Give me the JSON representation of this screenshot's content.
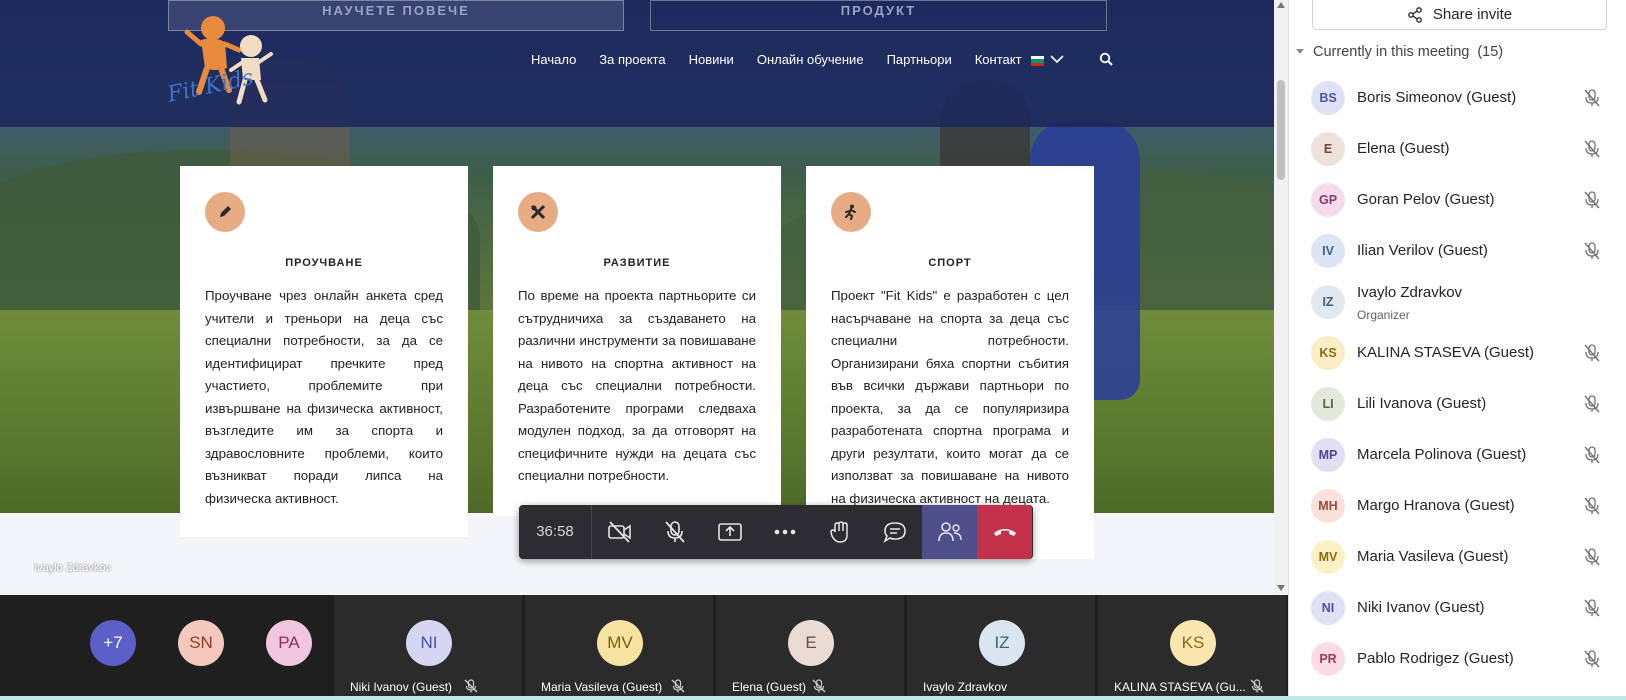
{
  "website": {
    "top_buttons": [
      "НАУЧЕТЕ ПОВЕЧЕ",
      "ПРОДУКТ"
    ],
    "logo_text": "Fit Kids",
    "nav": [
      "Начало",
      "За проекта",
      "Новини",
      "Онлайн обучение",
      "Партньори",
      "Контакт"
    ],
    "cards": [
      {
        "title": "ПРОУЧВАНЕ",
        "icon": "pencil-icon",
        "text": "Проучване чрез онлайн анкета сред учители и треньори на деца със специални потребности, за да се идентифицират пречките пред участието, проблемите при извършване на физическа активност, възгледите им за спорта и здравословните проблеми, които възникват поради липса на физическа активност."
      },
      {
        "title": "РАЗВИТИЕ",
        "icon": "tools-icon",
        "text": "По време на проекта партньорите си сътрудничиха за създаването на различни инструменти за повишаване на нивото на спортна активност на деца със специални потребности. Разработените програми следваха модулен подход, за да отговорят на специфичните нужди на децата със специални потребности."
      },
      {
        "title": "СПОРТ",
        "icon": "runner-icon",
        "text": "Проект \"Fit Kids\" е разработен с цел насърчаване на спорта за деца със специални потребности. Организирани бяха спортни събития във всички държави партньори по проекта, за да се популяризира разработената спортна програма и други резултати, които могат да се използват за повишаване на нивото на физическа активност на децата."
      }
    ],
    "presenter_name": "Ivaylo Zdravkov"
  },
  "toolbar": {
    "timer": "36:58"
  },
  "strip": {
    "overflow": {
      "initials": "+7"
    },
    "small_avatars": [
      {
        "initials": "SN",
        "color": "#f4c9bb"
      },
      {
        "initials": "PA",
        "color": "#f1c6df"
      }
    ],
    "tiles": [
      {
        "initials": "NI",
        "name": "Niki Ivanov (Guest)",
        "color": "#d5d6f2",
        "muted": true
      },
      {
        "initials": "MV",
        "name": "Maria Vasileva (Guest)",
        "color": "#f7e3a1",
        "muted": true
      },
      {
        "initials": "E",
        "name": "Elena (Guest)",
        "color": "#eadbd3",
        "muted": true
      },
      {
        "initials": "IZ",
        "name": "Ivaylo Zdravkov",
        "color": "#d9e6ef",
        "muted": false
      },
      {
        "initials": "KS",
        "name": "KALINA STASEVA (Gu...",
        "color": "#fbe6b0",
        "muted": true
      }
    ]
  },
  "panel": {
    "share_label": "Share invite",
    "section_title": "Currently in this meeting",
    "count": "(15)",
    "participants": [
      {
        "initials": "BS",
        "name": "Boris Simeonov (Guest)",
        "bg": "#dfe2f6",
        "fg": "#4d56a0",
        "muted": true
      },
      {
        "initials": "E",
        "name": "Elena (Guest)",
        "bg": "#eee2db",
        "fg": "#6b4a3d",
        "muted": true
      },
      {
        "initials": "GP",
        "name": "Goran Pelov (Guest)",
        "bg": "#f5dcec",
        "fg": "#8a3b73",
        "muted": true
      },
      {
        "initials": "IV",
        "name": "Ilian Verilov (Guest)",
        "bg": "#dbe5f4",
        "fg": "#3f5e8e",
        "muted": true
      },
      {
        "initials": "IZ",
        "name": "Ivaylo Zdravkov",
        "role": "Organizer",
        "bg": "#dfe9ef",
        "fg": "#40606e",
        "muted": false
      },
      {
        "initials": "KS",
        "name": "KALINA STASEVA (Guest)",
        "bg": "#fbeec4",
        "fg": "#8a6a1a",
        "muted": true
      },
      {
        "initials": "LI",
        "name": "Lili Ivanova (Guest)",
        "bg": "#e3eadc",
        "fg": "#4f6840",
        "muted": true
      },
      {
        "initials": "MP",
        "name": "Marcela Polinova (Guest)",
        "bg": "#e1dff3",
        "fg": "#4f478e",
        "muted": true
      },
      {
        "initials": "MH",
        "name": "Margo Hranova (Guest)",
        "bg": "#fbe1dc",
        "fg": "#9a4a3a",
        "muted": true
      },
      {
        "initials": "MV",
        "name": "Maria Vasileva (Guest)",
        "bg": "#fbf0c6",
        "fg": "#8a6d10",
        "muted": true
      },
      {
        "initials": "NI",
        "name": "Niki Ivanov (Guest)",
        "bg": "#e1e2f6",
        "fg": "#4b51a0",
        "muted": true
      },
      {
        "initials": "PR",
        "name": "Pablo Rodrigez (Guest)",
        "bg": "#fadbe6",
        "fg": "#9a3a5c",
        "muted": true
      }
    ]
  }
}
